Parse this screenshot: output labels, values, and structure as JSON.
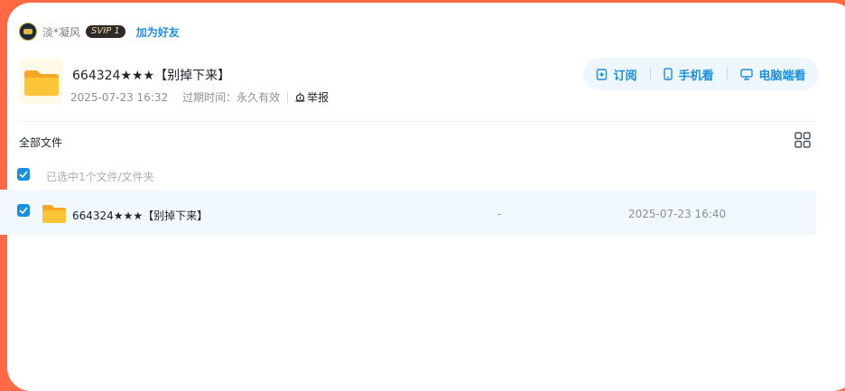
{
  "user": {
    "name": "淡*凝风",
    "vip_badge": "SVIP 1",
    "add_friend": "加为好友"
  },
  "share": {
    "title": "664324★★★【别掉下来】",
    "created": "2025-07-23 16:32",
    "expire_label": "过期时间：",
    "expire_value": "永久有效",
    "report": "举报"
  },
  "actions": {
    "subscribe": "订阅",
    "mobile": "手机看",
    "pc": "电脑端看"
  },
  "file_list": {
    "breadcrumb": "全部文件",
    "selected_info": "已选中1个文件/文件夹",
    "rows": [
      {
        "name": "664324★★★【别掉下来】",
        "size": "-",
        "date": "2025-07-23 16:40",
        "checked": true
      }
    ]
  },
  "colors": {
    "accent": "#1a8fe0",
    "background": "#ff6a45",
    "folder": "#fbbf24"
  },
  "icons": [
    "folder-icon",
    "subscribe-icon",
    "phone-icon",
    "monitor-icon",
    "report-icon",
    "grid-view-icon",
    "checkbox-checked-icon"
  ]
}
